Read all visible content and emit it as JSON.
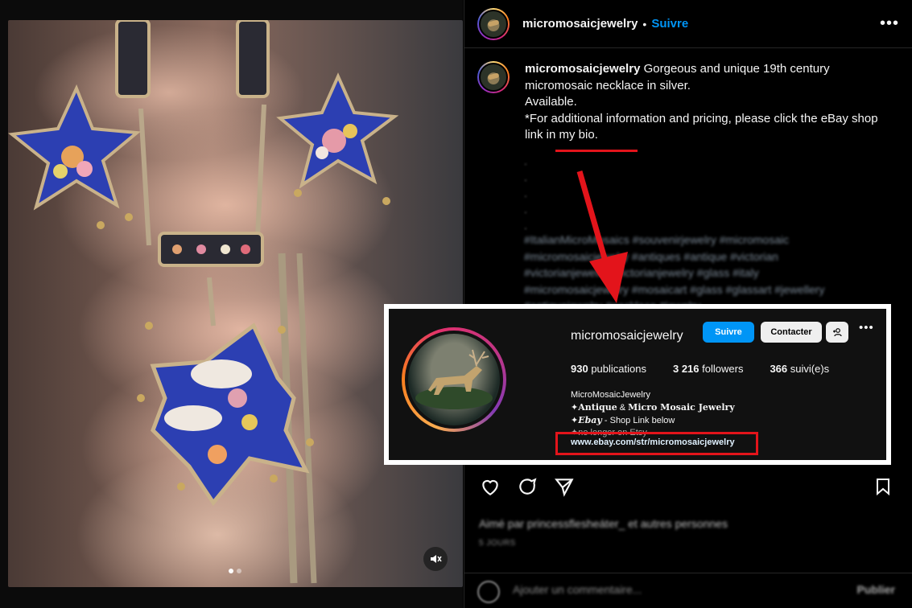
{
  "post": {
    "username": "micromosaicjewelry",
    "separator": "•",
    "follow_label": "Suivre",
    "more_icon": "more-horizontal-icon"
  },
  "caption": {
    "username": "micromosaicjewelry",
    "line1": "Gorgeous and unique 19th century micromosaic necklace in silver.",
    "line2": "Available.",
    "line3_prefix": "*For additional information and pricing, please click the eBay shop ",
    "line3_link": "link in my bio.",
    "annotation_color": "#e3141b"
  },
  "hashtags": "#ItalianMicroMosaics #souvenirjewelry #micromosaic #micromosaicjewelry #antiques #antique #victorian #victorianjewelry #victorianjewelry #glass #italy #micromosaicjewelry #mosaicart #glass #glassart #jewellery #antiquejewelry #necklace #jewelry",
  "actions": [
    "heart-icon",
    "comment-icon",
    "share-icon",
    "bookmark-icon"
  ],
  "likes_text": "Aimé par princessflesheáter_ et autres personnes",
  "date_text": "5 JOURS",
  "comment": {
    "placeholder": "Ajouter un commentaire...",
    "publish_label": "Publier"
  },
  "media": {
    "carousel_count": 2,
    "carousel_active": 0
  },
  "profile_card": {
    "username": "micromosaicjewelry",
    "follow_label": "Suivre",
    "contact_label": "Contacter",
    "publications_count": "930",
    "publications_label": "publications",
    "followers_count": "3 216",
    "followers_label": "followers",
    "following_count": "366",
    "following_label": "suivi(e)s",
    "bio_name": "MicroMosaicJewelry",
    "bio_line1_prefix": "✦",
    "bio_line1_a": "Antique",
    "bio_line1_amp": " & ",
    "bio_line1_b": "Micro Mosaic Jewelry",
    "bio_line2_prefix": "✦",
    "bio_line2_a": "Ebay",
    "bio_line2_b": " - Shop Link below",
    "bio_line3": "✦no longer on Etsy",
    "link": "www.ebay.com/str/micromosaicjewelry"
  },
  "colors": {
    "accent": "#0095f6",
    "annotation": "#e3141b",
    "background": "#000000"
  }
}
